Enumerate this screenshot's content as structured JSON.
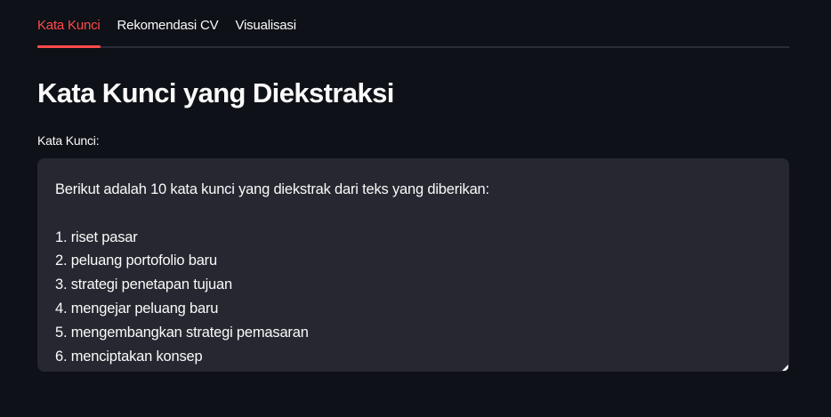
{
  "tabs": [
    {
      "label": "Kata Kunci",
      "active": true
    },
    {
      "label": "Rekomendasi CV",
      "active": false
    },
    {
      "label": "Visualisasi",
      "active": false
    }
  ],
  "main": {
    "title": "Kata Kunci yang Diekstraksi",
    "field_label": "Kata Kunci:",
    "textarea_lines": [
      "Berikut adalah 10 kata kunci yang diekstrak dari teks yang diberikan:",
      "",
      "1. riset pasar",
      "2. peluang portofolio baru",
      "3. strategi penetapan tujuan",
      "4. mengejar peluang baru",
      "5. mengembangkan strategi pemasaran",
      "6. menciptakan konsep"
    ]
  },
  "colors": {
    "background": "#0e1117",
    "accent": "#ff4b4b",
    "textarea_bg": "#262730",
    "text": "#fafafa"
  },
  "icons": {
    "resize_handle": "resize-handle-icon"
  }
}
